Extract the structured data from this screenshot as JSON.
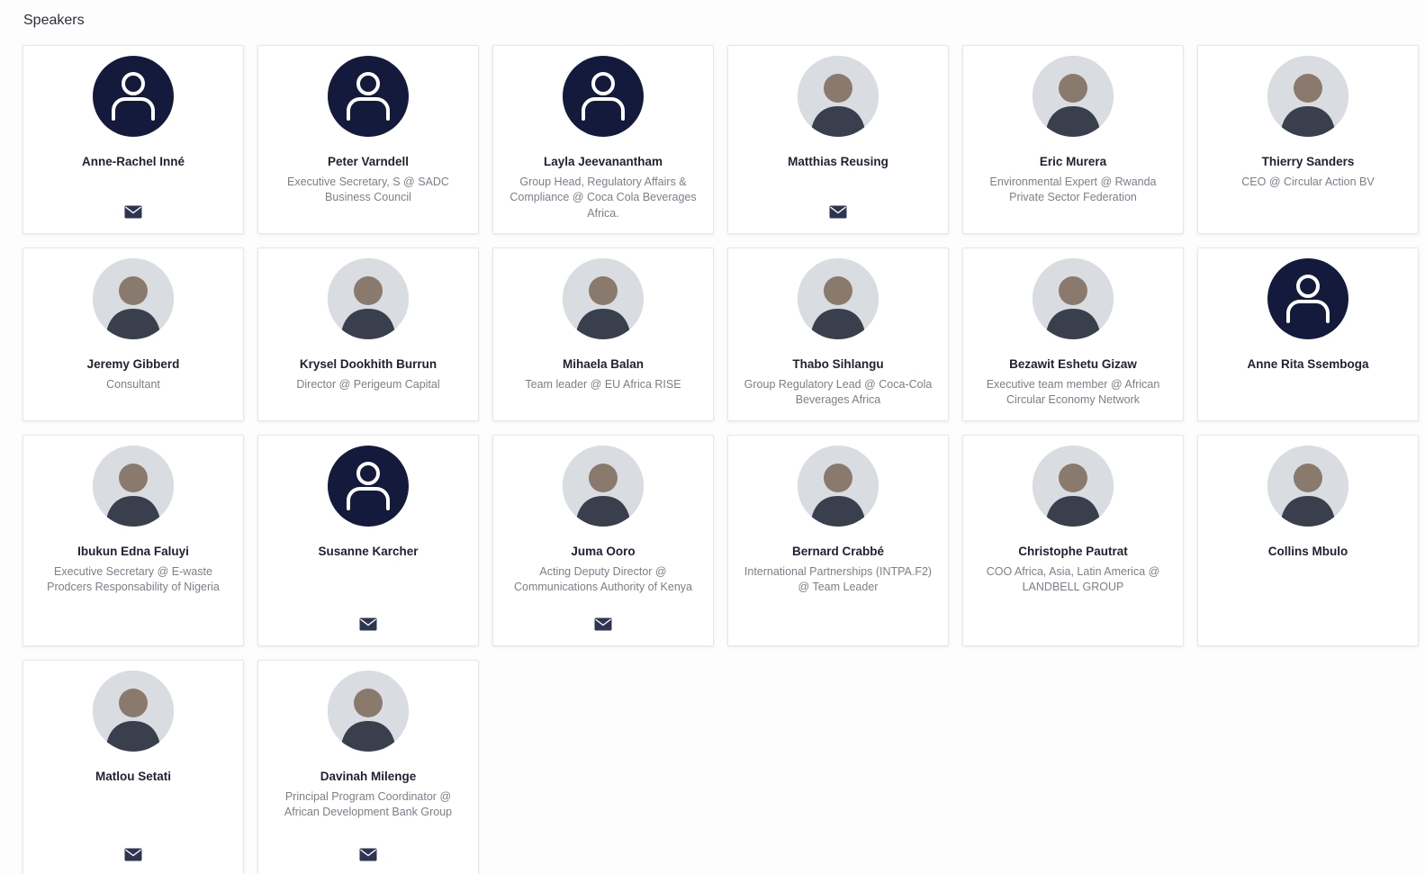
{
  "page": {
    "title": "Speakers"
  },
  "colors": {
    "placeholder_avatar": "#141a3c",
    "mail_icon": "#2d3550"
  },
  "speakers": [
    {
      "name": "Anne-Rachel Inné",
      "role": "",
      "avatar": "placeholder-user-icon",
      "email": true
    },
    {
      "name": "Peter Varndell",
      "role": "Executive Secretary, S @ SADC Business Council",
      "avatar": "placeholder-user-icon",
      "email": false
    },
    {
      "name": "Layla Jeevanantham",
      "role": "Group Head, Regulatory Affairs & Compliance @ Coca Cola Beverages Africa.",
      "avatar": "placeholder-user-icon",
      "email": false
    },
    {
      "name": "Matthias Reusing",
      "role": "",
      "avatar": "photo",
      "email": true
    },
    {
      "name": "Eric Murera",
      "role": "Environmental Expert @ Rwanda Private Sector Federation",
      "avatar": "photo",
      "email": false
    },
    {
      "name": "Thierry Sanders",
      "role": "CEO @ Circular Action BV",
      "avatar": "photo",
      "email": false
    },
    {
      "name": "Jeremy Gibberd",
      "role": "Consultant",
      "avatar": "photo",
      "email": false
    },
    {
      "name": "Krysel Dookhith Burrun",
      "role": "Director @ Perigeum Capital",
      "avatar": "photo",
      "email": false
    },
    {
      "name": "Mihaela Balan",
      "role": "Team leader @ EU Africa RISE",
      "avatar": "photo",
      "email": false
    },
    {
      "name": "Thabo Sihlangu",
      "role": "Group Regulatory Lead @ Coca-Cola Beverages Africa",
      "avatar": "photo",
      "email": false
    },
    {
      "name": "Bezawit Eshetu Gizaw",
      "role": "Executive team member @ African Circular Economy Network",
      "avatar": "photo",
      "email": false
    },
    {
      "name": "Anne Rita Ssemboga",
      "role": "",
      "avatar": "placeholder-user-icon",
      "email": false
    },
    {
      "name": "Ibukun Edna Faluyi",
      "role": "Executive Secretary @ E-waste Prodcers Responsability of Nigeria",
      "avatar": "photo",
      "email": false
    },
    {
      "name": "Susanne Karcher",
      "role": "",
      "avatar": "placeholder-user-icon",
      "email": true
    },
    {
      "name": "Juma Ooro",
      "role": "Acting Deputy Director @ Communications Authority of Kenya",
      "avatar": "photo",
      "email": true
    },
    {
      "name": "Bernard Crabbé",
      "role": "International Partnerships (INTPA.F2) @ Team Leader",
      "avatar": "photo",
      "email": false
    },
    {
      "name": "Christophe Pautrat",
      "role": "COO Africa, Asia, Latin America @ LANDBELL GROUP",
      "avatar": "photo",
      "email": false
    },
    {
      "name": "Collins Mbulo",
      "role": "",
      "avatar": "photo",
      "email": false
    },
    {
      "name": "Matlou Setati",
      "role": "",
      "avatar": "photo",
      "email": true
    },
    {
      "name": "Davinah Milenge",
      "role": "Principal Program Coordinator @ African Development Bank Group",
      "avatar": "photo",
      "email": true
    }
  ]
}
